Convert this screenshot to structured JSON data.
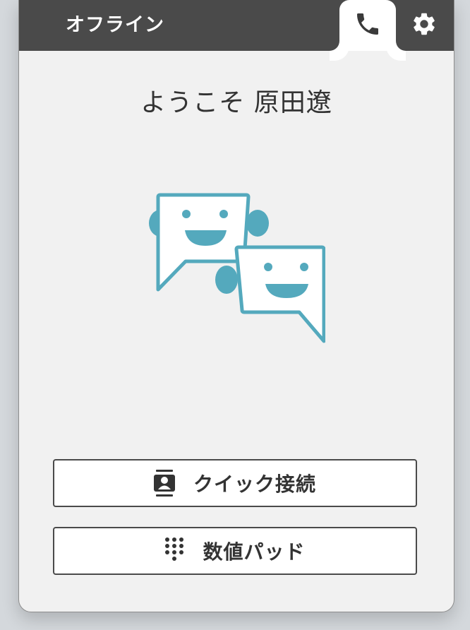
{
  "header": {
    "status": "オフライン",
    "phone_tab_icon": "phone-icon",
    "settings_icon": "gear-icon",
    "background_color": "#4a4a4a"
  },
  "main": {
    "welcome_text": "ようこそ 原田遼",
    "illustration_icon": "chat-bubbles-icon",
    "accent_color": "#54a9bd"
  },
  "actions": {
    "quick_connect": {
      "label": "クイック接続",
      "icon": "contact-card-icon"
    },
    "dialpad": {
      "label": "数値パッド",
      "icon": "dialpad-icon"
    }
  }
}
